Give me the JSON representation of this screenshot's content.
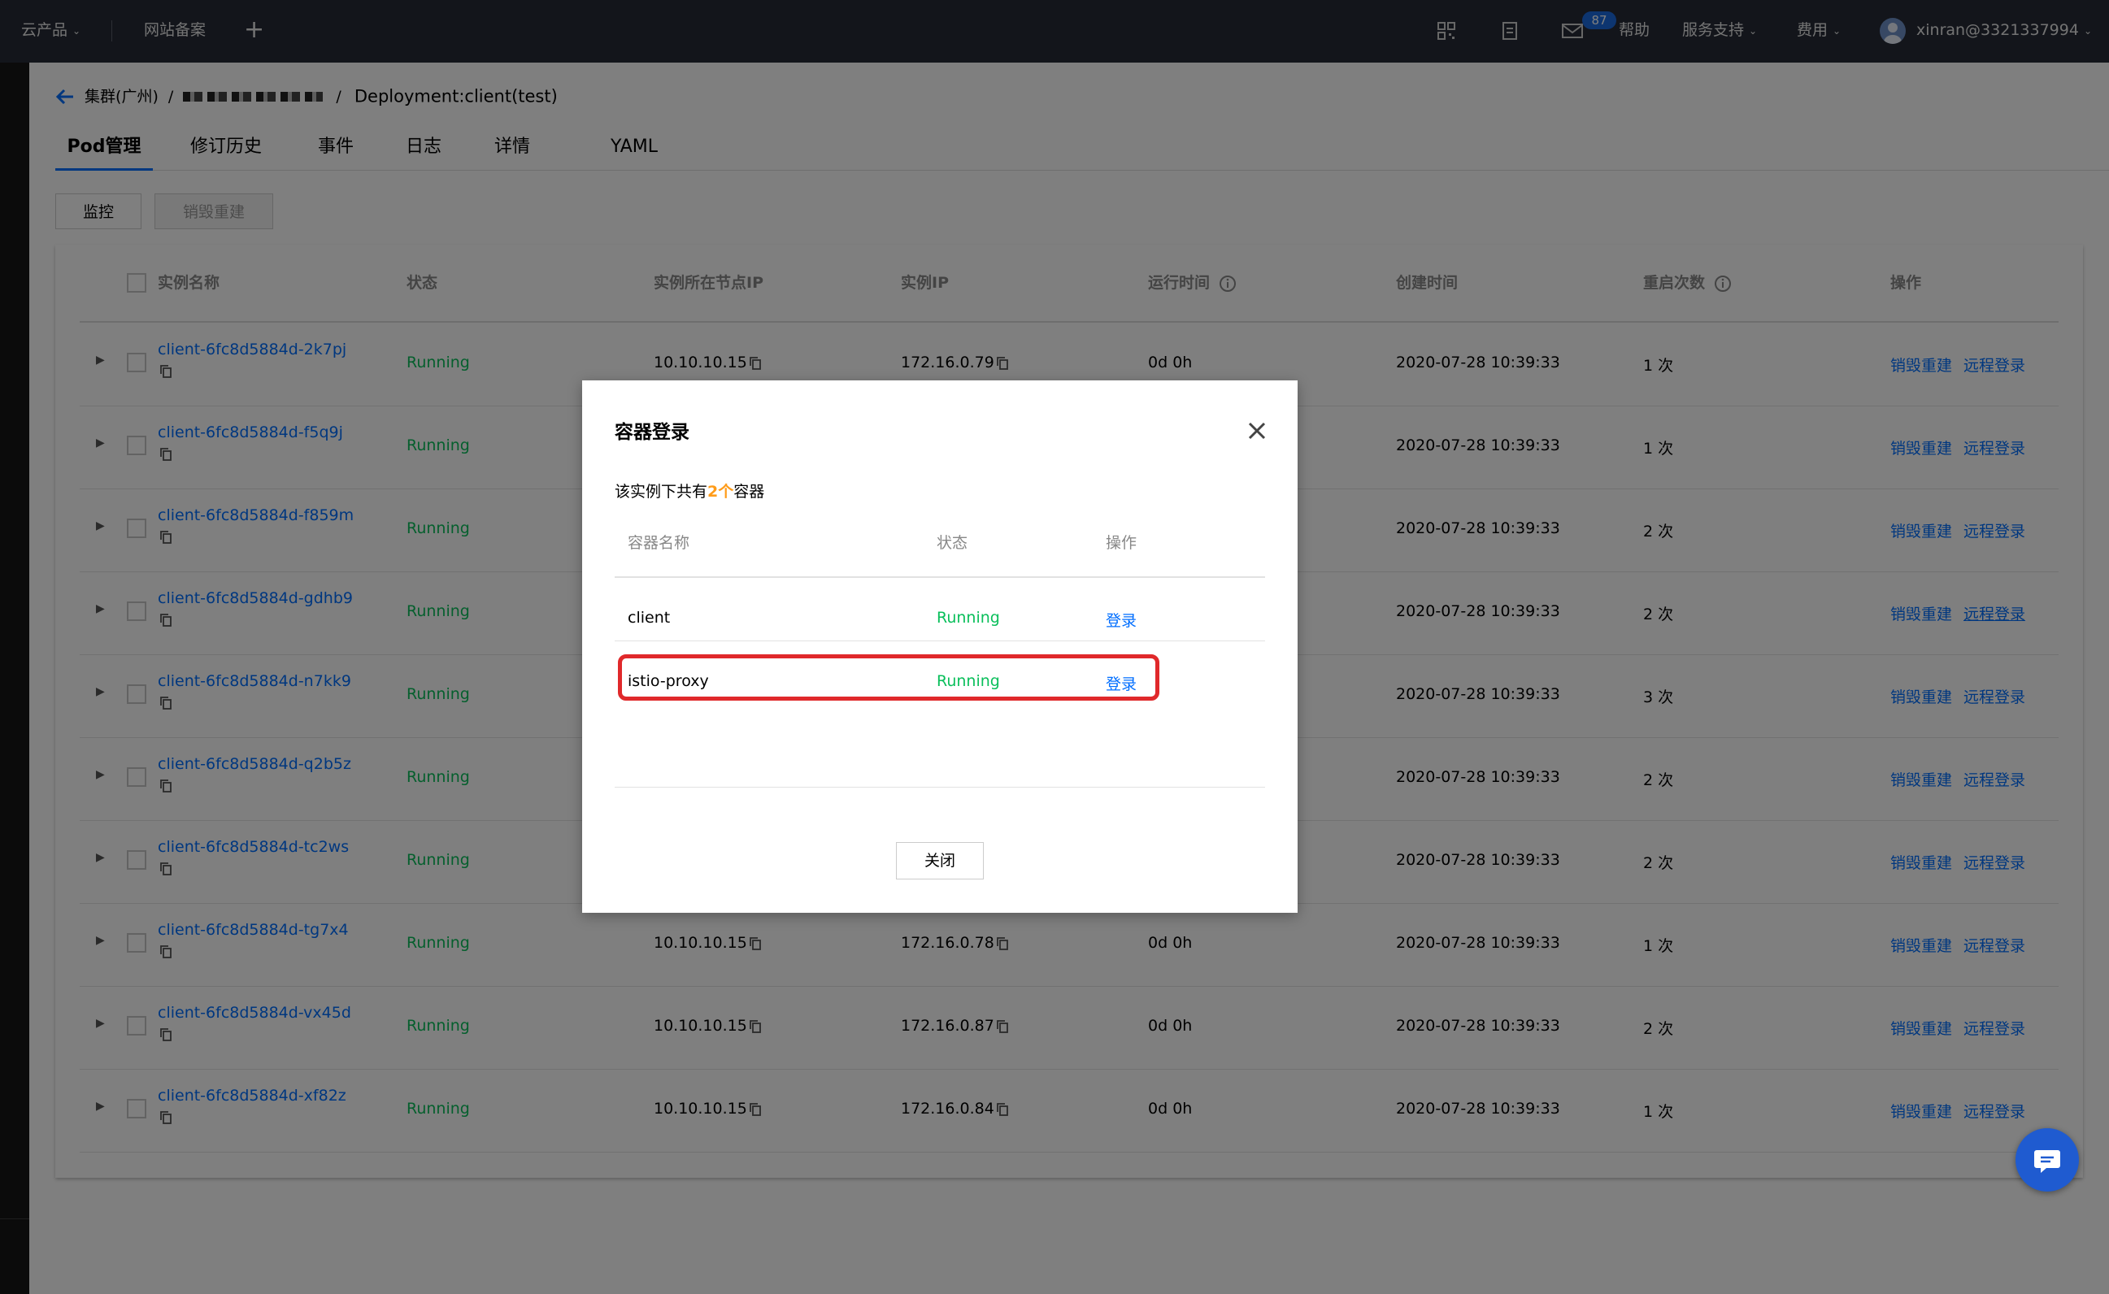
{
  "topbar": {
    "products": "云产品",
    "icp": "网站备案",
    "plus": "+",
    "mail_badge": "87",
    "help": "帮助",
    "support": "服务支持",
    "billing": "费用",
    "user": "xinran@3321337994"
  },
  "breadcrumb": {
    "cluster": "集群(广州)",
    "sep": "/",
    "sep2": "/",
    "current": "Deployment:client(test)"
  },
  "tabs": [
    "Pod管理",
    "修订历史",
    "事件",
    "日志",
    "详情",
    "YAML"
  ],
  "toolbar": {
    "monitor": "监控",
    "destroy_rebuild": "销毁重建"
  },
  "table": {
    "headers": [
      "实例名称",
      "状态",
      "实例所在节点IP",
      "实例IP",
      "运行时间",
      "创建时间",
      "重启次数",
      "操作"
    ],
    "rows": [
      {
        "name": "client-6fc8d5884d-2k7pj",
        "status": "Running",
        "node_ip": "10.10.10.15",
        "pod_ip": "172.16.0.79",
        "runtime": "0d 0h",
        "created": "2020-07-28 10:39:33",
        "restarts": "1 次",
        "op1": "销毁重建",
        "op2": "远程登录"
      },
      {
        "name": "client-6fc8d5884d-f5q9j",
        "status": "Running",
        "node_ip": "",
        "pod_ip": "",
        "runtime": "",
        "created": "2020-07-28 10:39:33",
        "restarts": "1 次",
        "op1": "销毁重建",
        "op2": "远程登录"
      },
      {
        "name": "client-6fc8d5884d-f859m",
        "status": "Running",
        "node_ip": "",
        "pod_ip": "",
        "runtime": "",
        "created": "2020-07-28 10:39:33",
        "restarts": "2 次",
        "op1": "销毁重建",
        "op2": "远程登录"
      },
      {
        "name": "client-6fc8d5884d-gdhb9",
        "status": "Running",
        "node_ip": "",
        "pod_ip": "",
        "runtime": "",
        "created": "2020-07-28 10:39:33",
        "restarts": "2 次",
        "op1": "销毁重建",
        "op2": "远程登录"
      },
      {
        "name": "client-6fc8d5884d-n7kk9",
        "status": "Running",
        "node_ip": "",
        "pod_ip": "",
        "runtime": "",
        "created": "2020-07-28 10:39:33",
        "restarts": "3 次",
        "op1": "销毁重建",
        "op2": "远程登录"
      },
      {
        "name": "client-6fc8d5884d-q2b5z",
        "status": "Running",
        "node_ip": "",
        "pod_ip": "",
        "runtime": "",
        "created": "2020-07-28 10:39:33",
        "restarts": "2 次",
        "op1": "销毁重建",
        "op2": "远程登录"
      },
      {
        "name": "client-6fc8d5884d-tc2ws",
        "status": "Running",
        "node_ip": "",
        "pod_ip": "",
        "runtime": "",
        "created": "2020-07-28 10:39:33",
        "restarts": "2 次",
        "op1": "销毁重建",
        "op2": "远程登录"
      },
      {
        "name": "client-6fc8d5884d-tg7x4",
        "status": "Running",
        "node_ip": "10.10.10.15",
        "pod_ip": "172.16.0.78",
        "runtime": "0d 0h",
        "created": "2020-07-28 10:39:33",
        "restarts": "1 次",
        "op1": "销毁重建",
        "op2": "远程登录"
      },
      {
        "name": "client-6fc8d5884d-vx45d",
        "status": "Running",
        "node_ip": "10.10.10.15",
        "pod_ip": "172.16.0.87",
        "runtime": "0d 0h",
        "created": "2020-07-28 10:39:33",
        "restarts": "2 次",
        "op1": "销毁重建",
        "op2": "远程登录"
      },
      {
        "name": "client-6fc8d5884d-xf82z",
        "status": "Running",
        "node_ip": "10.10.10.15",
        "pod_ip": "172.16.0.84",
        "runtime": "0d 0h",
        "created": "2020-07-28 10:39:33",
        "restarts": "1 次",
        "op1": "销毁重建",
        "op2": "远程登录"
      }
    ]
  },
  "modal": {
    "title": "容器登录",
    "desc_prefix": "该实例下共有",
    "desc_count": "2个",
    "desc_suffix": "容器",
    "headers": [
      "容器名称",
      "状态",
      "操作"
    ],
    "rows": [
      {
        "name": "client",
        "status": "Running",
        "action": "登录"
      },
      {
        "name": "istio-proxy",
        "status": "Running",
        "action": "登录"
      }
    ],
    "close_button": "关闭"
  },
  "colors": {
    "topbar_bg": "#262b37",
    "link": "#006eff",
    "running": "#0abf5b",
    "count_highlight": "#ff9c19",
    "highlight_box": "#e0292b"
  }
}
